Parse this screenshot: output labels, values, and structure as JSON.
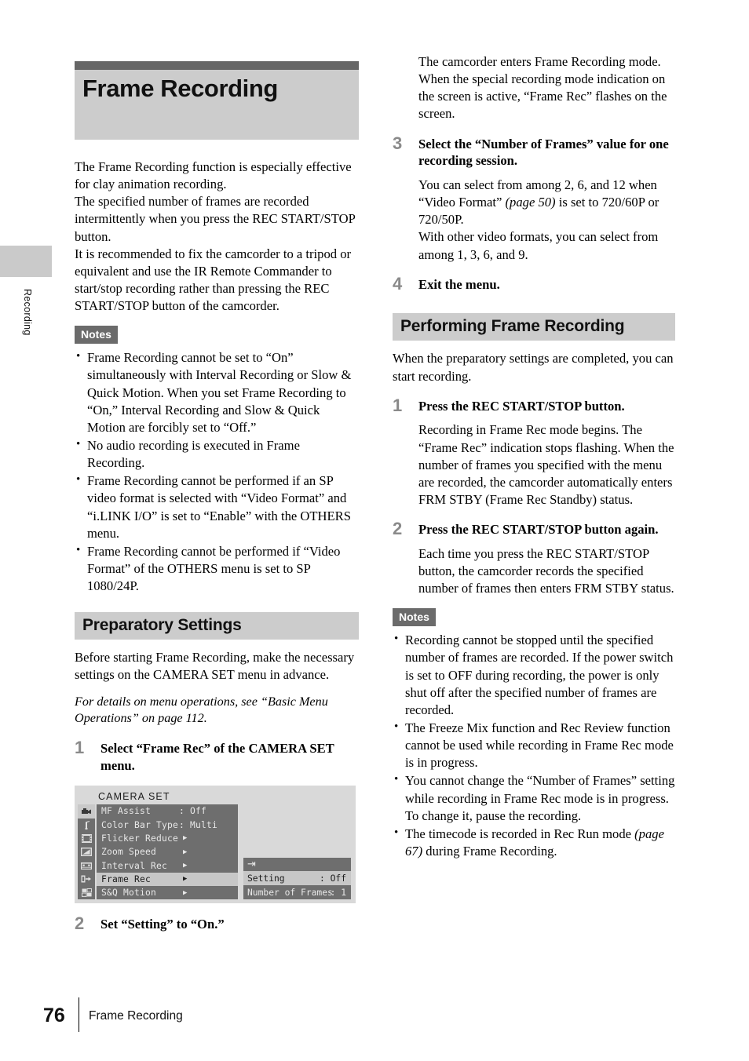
{
  "page": {
    "number": "76",
    "footer_title": "Frame Recording",
    "side_tab_label": "Recording"
  },
  "chapter": {
    "title": "Frame Recording"
  },
  "intro": {
    "para1": "The Frame Recording function is especially effective for clay animation recording.",
    "para2": "The specified number of frames are recorded intermittently when you press the REC START/STOP button.",
    "para3": "It is recommended to fix the camcorder to a tripod or equivalent and use the IR Remote Commander to start/stop recording rather than pressing the REC START/STOP button of the camcorder."
  },
  "notes_label": "Notes",
  "notes_left": [
    "Frame Recording cannot be set to “On” simultaneously with Interval Recording or Slow & Quick Motion. When you set Frame Recording to “On,” Interval Recording and Slow & Quick Motion are forcibly set to “Off.”",
    "No audio recording is executed in Frame Recording.",
    "Frame Recording cannot be performed if an SP video format is selected with “Video Format” and “i.LINK I/O” is set to “Enable” with the OTHERS menu.",
    "Frame Recording cannot be performed if “Video Format” of the OTHERS menu is set to SP 1080/24P."
  ],
  "preparatory": {
    "heading": "Preparatory Settings",
    "intro": "Before starting Frame Recording, make the necessary settings on the CAMERA SET menu in advance.",
    "italic_note": "For details on menu operations, see “Basic Menu Operations” on page 112.",
    "step1": {
      "num": "1",
      "lead": "Select “Frame Rec” of the CAMERA SET menu."
    },
    "step2": {
      "num": "2",
      "lead": "Set “Setting” to “On.”"
    }
  },
  "menu_screenshot": {
    "title": "CAMERA SET",
    "icons": [
      "camera-icon",
      "audio-note-icon",
      "film-strip-icon",
      "lcd-screen-icon",
      "tape-cassette-icon",
      "video-out-icon",
      "others-grid-icon"
    ],
    "rows": [
      {
        "label": "MF Assist",
        "value": ": Off",
        "arrow": "",
        "selected": false
      },
      {
        "label": "Color Bar Type",
        "value": ": Multi",
        "arrow": "",
        "selected": false
      },
      {
        "label": "Flicker Reduce",
        "value": "",
        "arrow": "▶",
        "selected": false
      },
      {
        "label": "Zoom Speed",
        "value": "",
        "arrow": "▶",
        "selected": false
      },
      {
        "label": "Interval Rec",
        "value": "",
        "arrow": "▶",
        "selected": false
      },
      {
        "label": "Frame Rec",
        "value": "",
        "arrow": "▶",
        "selected": true
      },
      {
        "label": "S&Q Motion",
        "value": "",
        "arrow": "▶",
        "selected": false
      }
    ],
    "submenu": {
      "return_icon": "↵",
      "rows": [
        {
          "label": "Setting",
          "value": ": Off",
          "selected": true
        },
        {
          "label": "Number of Frames",
          "value": ": 1",
          "selected": false
        }
      ]
    }
  },
  "right": {
    "cont_para1": "The camcorder enters Frame Recording mode.",
    "cont_para2": "When the special recording mode indication on the screen is active, “Frame Rec” flashes on the screen.",
    "step3": {
      "num": "3",
      "lead": "Select the “Number of Frames” value for one recording session.",
      "sub_a1": "You can select from among 2, 6, and 12 when “Video Format” ",
      "sub_a_page": "(page 50)",
      "sub_a2": " is set to 720/60P or 720/50P.",
      "sub_b": "With other video formats, you can select from among 1, 3, 6, and 9."
    },
    "step4": {
      "num": "4",
      "lead": "Exit the menu."
    },
    "performing": {
      "heading": "Performing Frame Recording",
      "intro": "When the preparatory settings are completed, you can start recording.",
      "step1": {
        "num": "1",
        "lead": "Press the REC START/STOP button.",
        "sub": "Recording in Frame Rec mode begins. The “Frame Rec” indication stops flashing. When the number of frames you specified with the menu are recorded, the camcorder automatically enters FRM STBY (Frame Rec Standby) status."
      },
      "step2": {
        "num": "2",
        "lead": "Press the REC START/STOP button again.",
        "sub": "Each time you press the REC START/STOP button, the camcorder records the specified number of frames then enters FRM STBY status."
      }
    },
    "notes": [
      "Recording cannot be stopped until the specified number of frames are recorded. If the power switch is set to OFF during recording, the power is only shut off after the specified number of frames are recorded.",
      "The Freeze Mix function and Rec Review function cannot be used while recording in Frame Rec mode is in progress.",
      "You cannot change the “Number of Frames” setting while recording in Frame Rec mode is in progress. To change it, pause the recording.",
      "The timecode is recorded in Rec Run mode "
    ],
    "note4_page": "(page 67)",
    "note4_tail": " during Frame Recording."
  },
  "colors": {
    "banner_bg": "#cccccc",
    "banner_topbar": "#666666",
    "section_bar_bg": "#cccccc",
    "notes_badge_bg": "#6b6b6b",
    "step_number": "#8a8a8a",
    "menu_bg": "#d9d9d9",
    "menu_panel": "#6e6e6e",
    "menu_selected": "#c7c7c7"
  }
}
